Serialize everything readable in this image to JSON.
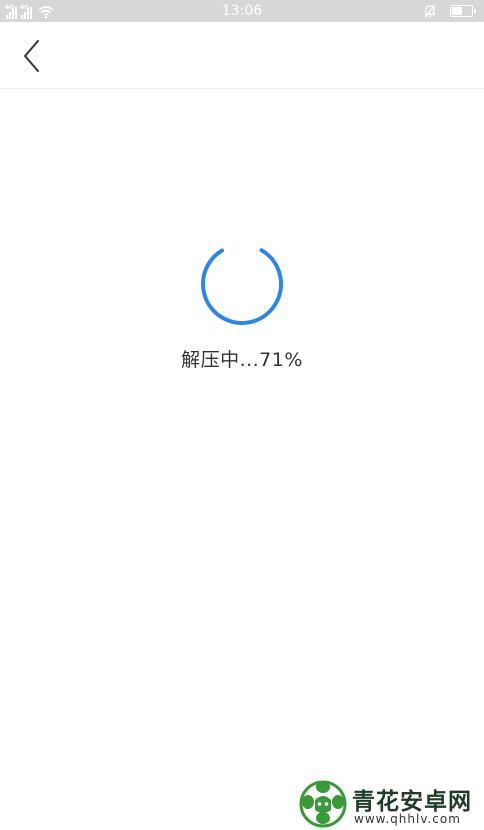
{
  "status_bar": {
    "time": "13:06",
    "signal_1_label": "4G",
    "signal_2_label": "4G",
    "icons": [
      "signal-icon",
      "signal-icon",
      "wifi-icon",
      "silent-bell-icon",
      "battery-icon"
    ],
    "battery_level": 0.5
  },
  "header": {
    "back_icon": "chevron-left-icon"
  },
  "loading": {
    "status_text": "解压中...71%",
    "progress": 0.71,
    "accent_color": "#2b85f0"
  },
  "watermark": {
    "name": "青花安卓网",
    "url": "www.qhhlv.com"
  }
}
